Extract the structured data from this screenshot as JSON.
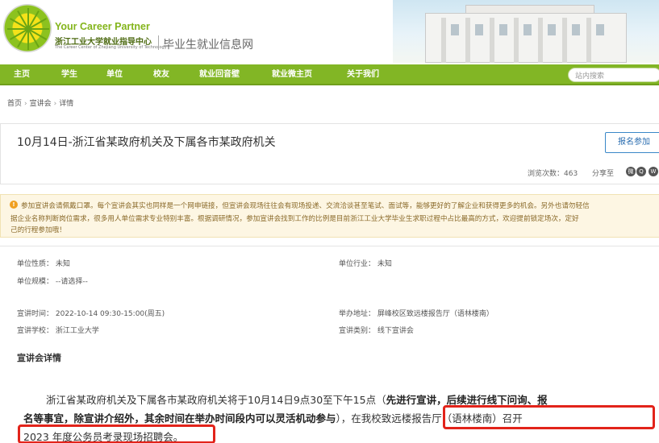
{
  "header": {
    "brand_en": "Your Career Partner",
    "brand_cn": "浙江工业大学就业指导中心",
    "brand_sub": "The Career Center of Zhejiang University of Technology",
    "site_name": "毕业生就业信息网"
  },
  "nav": {
    "items": [
      "主页",
      "学生",
      "单位",
      "校友",
      "就业回音壁",
      "就业微主页",
      "关于我们"
    ],
    "search_placeholder": "站内搜索"
  },
  "breadcrumb": [
    "首页",
    "宣讲会",
    "详情"
  ],
  "event": {
    "title": "10月14日-浙江省某政府机关及下属各市某政府机关",
    "signup_label": "报名参加",
    "views": "浏览次数：463",
    "share_label": "分享至"
  },
  "notice": {
    "icon": "!",
    "lines": [
      "参加宣讲会请佩戴口罩。每个宣讲会其实也同样是一个网申链接，但宣讲会现场往往会有现场投递、交流洽谈甚至笔试、面试等，能够更好的了解企业和获得更多的机会。另外也请勿轻信",
      "据企业名称判断岗位需求，很多用人单位需求专业特别丰富。根据调研情况，参加宣讲会找到工作的比例是目前浙江工业大学毕业生求职过程中占比最高的方式，欢迎提前锁定场次，定好",
      "己的行程参加哦！"
    ]
  },
  "fields": {
    "unit_nature": "单位性质：  未知",
    "unit_industry": "单位行业：  未知",
    "unit_scale": "单位规模：  --请选择--",
    "time": "宣讲时间：  2022-10-14 09:30-15:00(周五)",
    "venue": "举办地址：  屏峰校区致远楼报告厅（语林楼南）",
    "school": "宣讲学校：  浙江工业大学",
    "category": "宣讲类别：  线下宣讲会"
  },
  "details": {
    "section_title": "宣讲会详情",
    "line1_normal": "浙江省某政府机关及下属各市某政府机关将于10月14日9点30至下午15点（",
    "line1_bold": "先进行宣讲，后续进行线下问询、报",
    "line2_bold": "名等事宜，除宣讲介绍外，其余时间在举办时间段内可以灵活机动参与",
    "line2_normal": "），",
    "line2_highlight": "在我校致远楼报告厅（语林楼南）召开",
    "line3_highlight": "2023 年度公务员考录现场招聘会。"
  },
  "colors": {
    "nav_green": "#82b625",
    "brand_green": "#84b51c",
    "signup_blue": "#2a6db0",
    "highlight_red": "#e2231a",
    "notice_bg": "#fdf6e3"
  }
}
